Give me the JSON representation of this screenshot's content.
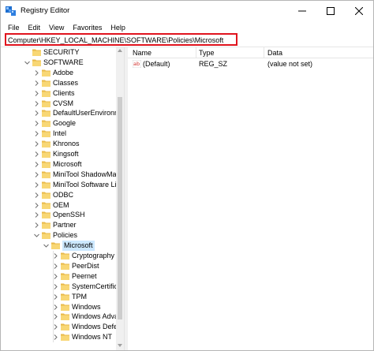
{
  "window": {
    "title": "Registry Editor",
    "accent": "#e0141e",
    "selection_color": "#cce8ff",
    "folder_color": "#f8d775"
  },
  "menu": [
    "File",
    "Edit",
    "View",
    "Favorites",
    "Help"
  ],
  "address": {
    "value": "Computer\\HKEY_LOCAL_MACHINE\\SOFTWARE\\Policies\\Microsoft"
  },
  "tree": {
    "items": [
      {
        "label": "SECURITY",
        "expander": "none",
        "icon": "folder-icon"
      },
      {
        "label": "SOFTWARE",
        "expander": "expanded",
        "icon": "folder-icon"
      },
      {
        "label": "Adobe",
        "expander": "collapsed",
        "icon": "folder-icon"
      },
      {
        "label": "Classes",
        "expander": "collapsed",
        "icon": "folder-icon"
      },
      {
        "label": "Clients",
        "expander": "collapsed",
        "icon": "folder-icon"
      },
      {
        "label": "CVSM",
        "expander": "collapsed",
        "icon": "folder-icon"
      },
      {
        "label": "DefaultUserEnvironn",
        "expander": "collapsed",
        "icon": "folder-icon"
      },
      {
        "label": "Google",
        "expander": "collapsed",
        "icon": "folder-icon"
      },
      {
        "label": "Intel",
        "expander": "collapsed",
        "icon": "folder-icon"
      },
      {
        "label": "Khronos",
        "expander": "collapsed",
        "icon": "folder-icon"
      },
      {
        "label": "Kingsoft",
        "expander": "collapsed",
        "icon": "folder-icon"
      },
      {
        "label": "Microsoft",
        "expander": "collapsed",
        "icon": "folder-icon"
      },
      {
        "label": "MiniTool ShadowMa",
        "expander": "collapsed",
        "icon": "folder-icon"
      },
      {
        "label": "MiniTool Software Li",
        "expander": "collapsed",
        "icon": "folder-icon"
      },
      {
        "label": "ODBC",
        "expander": "collapsed",
        "icon": "folder-icon"
      },
      {
        "label": "OEM",
        "expander": "collapsed",
        "icon": "folder-icon"
      },
      {
        "label": "OpenSSH",
        "expander": "collapsed",
        "icon": "folder-icon"
      },
      {
        "label": "Partner",
        "expander": "collapsed",
        "icon": "folder-icon"
      },
      {
        "label": "Policies",
        "expander": "expanded",
        "icon": "folder-icon"
      },
      {
        "label": "Microsoft",
        "expander": "expanded",
        "icon": "folder-open-icon",
        "selected": true
      },
      {
        "label": "Cryptography",
        "expander": "collapsed",
        "icon": "folder-icon"
      },
      {
        "label": "PeerDist",
        "expander": "collapsed",
        "icon": "folder-icon"
      },
      {
        "label": "Peernet",
        "expander": "collapsed",
        "icon": "folder-icon"
      },
      {
        "label": "SystemCertific",
        "expander": "collapsed",
        "icon": "folder-icon"
      },
      {
        "label": "TPM",
        "expander": "collapsed",
        "icon": "folder-icon"
      },
      {
        "label": "Windows",
        "expander": "collapsed",
        "icon": "folder-icon"
      },
      {
        "label": "Windows Adva",
        "expander": "collapsed",
        "icon": "folder-icon"
      },
      {
        "label": "Windows Defe",
        "expander": "collapsed",
        "icon": "folder-icon"
      },
      {
        "label": "Windows NT",
        "expander": "collapsed",
        "icon": "folder-icon"
      }
    ]
  },
  "list": {
    "columns": [
      "Name",
      "Type",
      "Data"
    ],
    "rows": [
      {
        "name": "(Default)",
        "type": "REG_SZ",
        "data": "(value not set)",
        "icon": "string-value-icon"
      }
    ]
  }
}
